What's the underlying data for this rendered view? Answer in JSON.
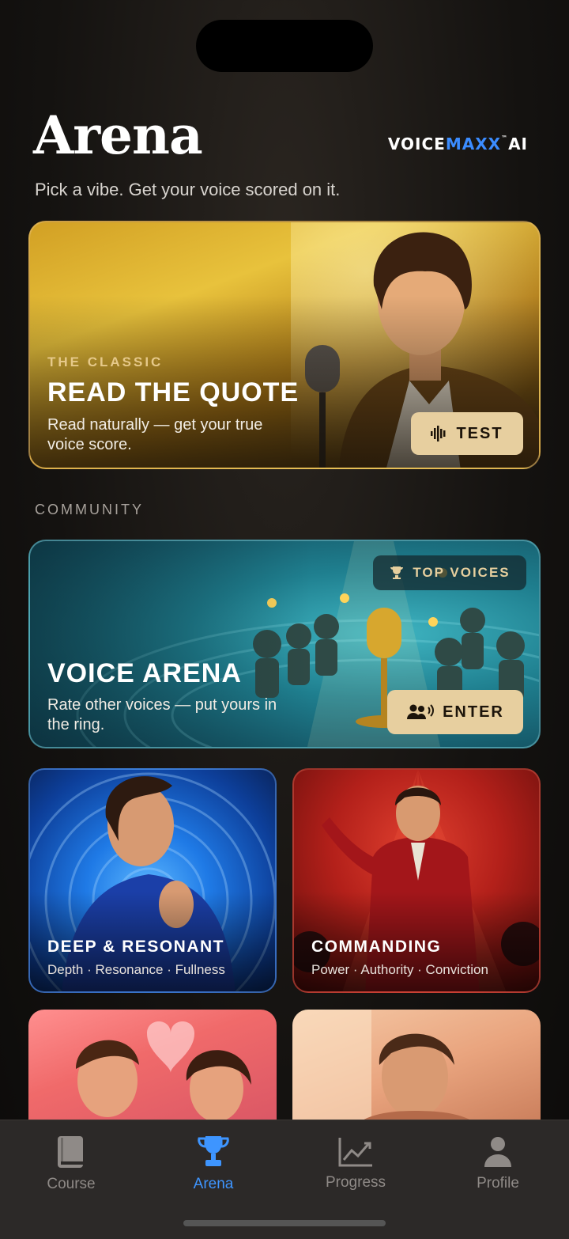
{
  "header": {
    "title": "Arena",
    "subtitle": "Pick a vibe. Get your voice scored on it.",
    "brand_part1": "VOICE",
    "brand_part2": "MAXX",
    "brand_tm": "™",
    "brand_part3": "AI"
  },
  "featured": {
    "eyebrow": "THE CLASSIC",
    "title": "READ THE QUOTE",
    "description_line1": "Read naturally — get your true",
    "description_line2": "voice score.",
    "button_label": "TEST",
    "button_icon": "waveform-icon"
  },
  "community": {
    "section_label": "COMMUNITY",
    "card": {
      "badge_label": "TOP VOICES",
      "badge_icon": "trophy-icon",
      "title": "VOICE ARENA",
      "description_line1": "Rate other voices — put yours in",
      "description_line2": "the ring.",
      "button_label": "ENTER",
      "button_icon": "group-voice-icon"
    }
  },
  "vibes": [
    {
      "title": "DEEP & RESONANT",
      "tags": "Depth · Resonance · Fullness"
    },
    {
      "title": "COMMANDING",
      "tags": "Power · Authority · Conviction"
    }
  ],
  "tabbar": {
    "items": [
      {
        "label": "Course",
        "icon": "book-icon",
        "active": false
      },
      {
        "label": "Arena",
        "icon": "trophy-icon",
        "active": true
      },
      {
        "label": "Progress",
        "icon": "chart-icon",
        "active": false
      },
      {
        "label": "Profile",
        "icon": "person-icon",
        "active": false
      }
    ]
  },
  "colors": {
    "accent_blue": "#3e95ff",
    "gold_button": "#e7cf9f",
    "background": "#141210"
  }
}
